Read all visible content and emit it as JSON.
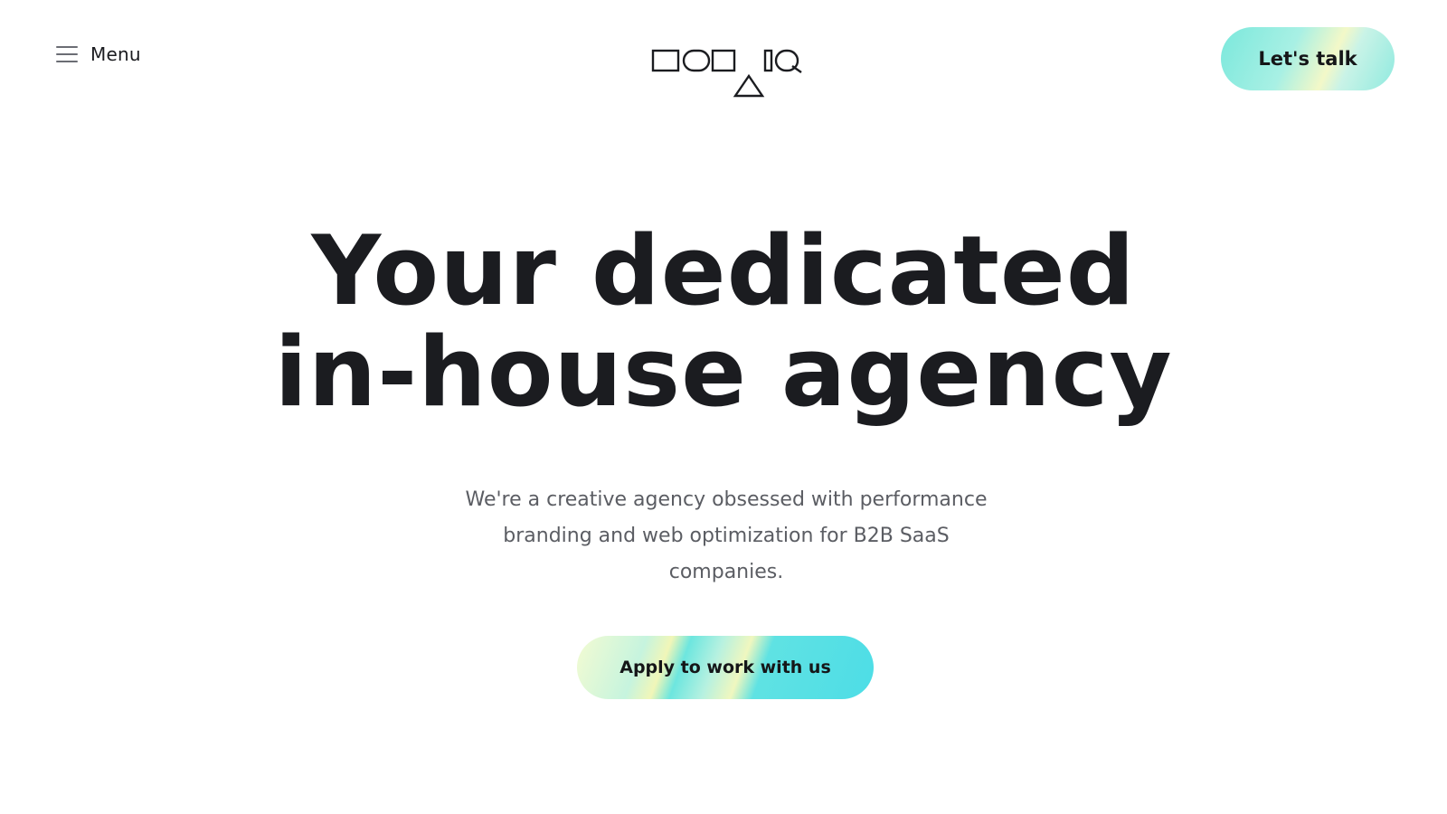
{
  "header": {
    "menu_label": "Menu",
    "menu_icon": "hamburger-icon",
    "logo_icon": "geometric-shapes-logo",
    "cta_label": "Let's talk"
  },
  "hero": {
    "title_line1": "Your dedicated",
    "title_line2": "in-house agency",
    "subtitle": "We're a creative agency obsessed with performance branding and web optimization for B2B SaaS companies.",
    "cta_label": "Apply to work with us"
  },
  "colors": {
    "text_dark": "#1b1c20",
    "text_muted": "#5b5d63",
    "accent_teal": "#5fe2e3",
    "accent_yellow": "#f1f6b8",
    "background": "#ffffff"
  }
}
